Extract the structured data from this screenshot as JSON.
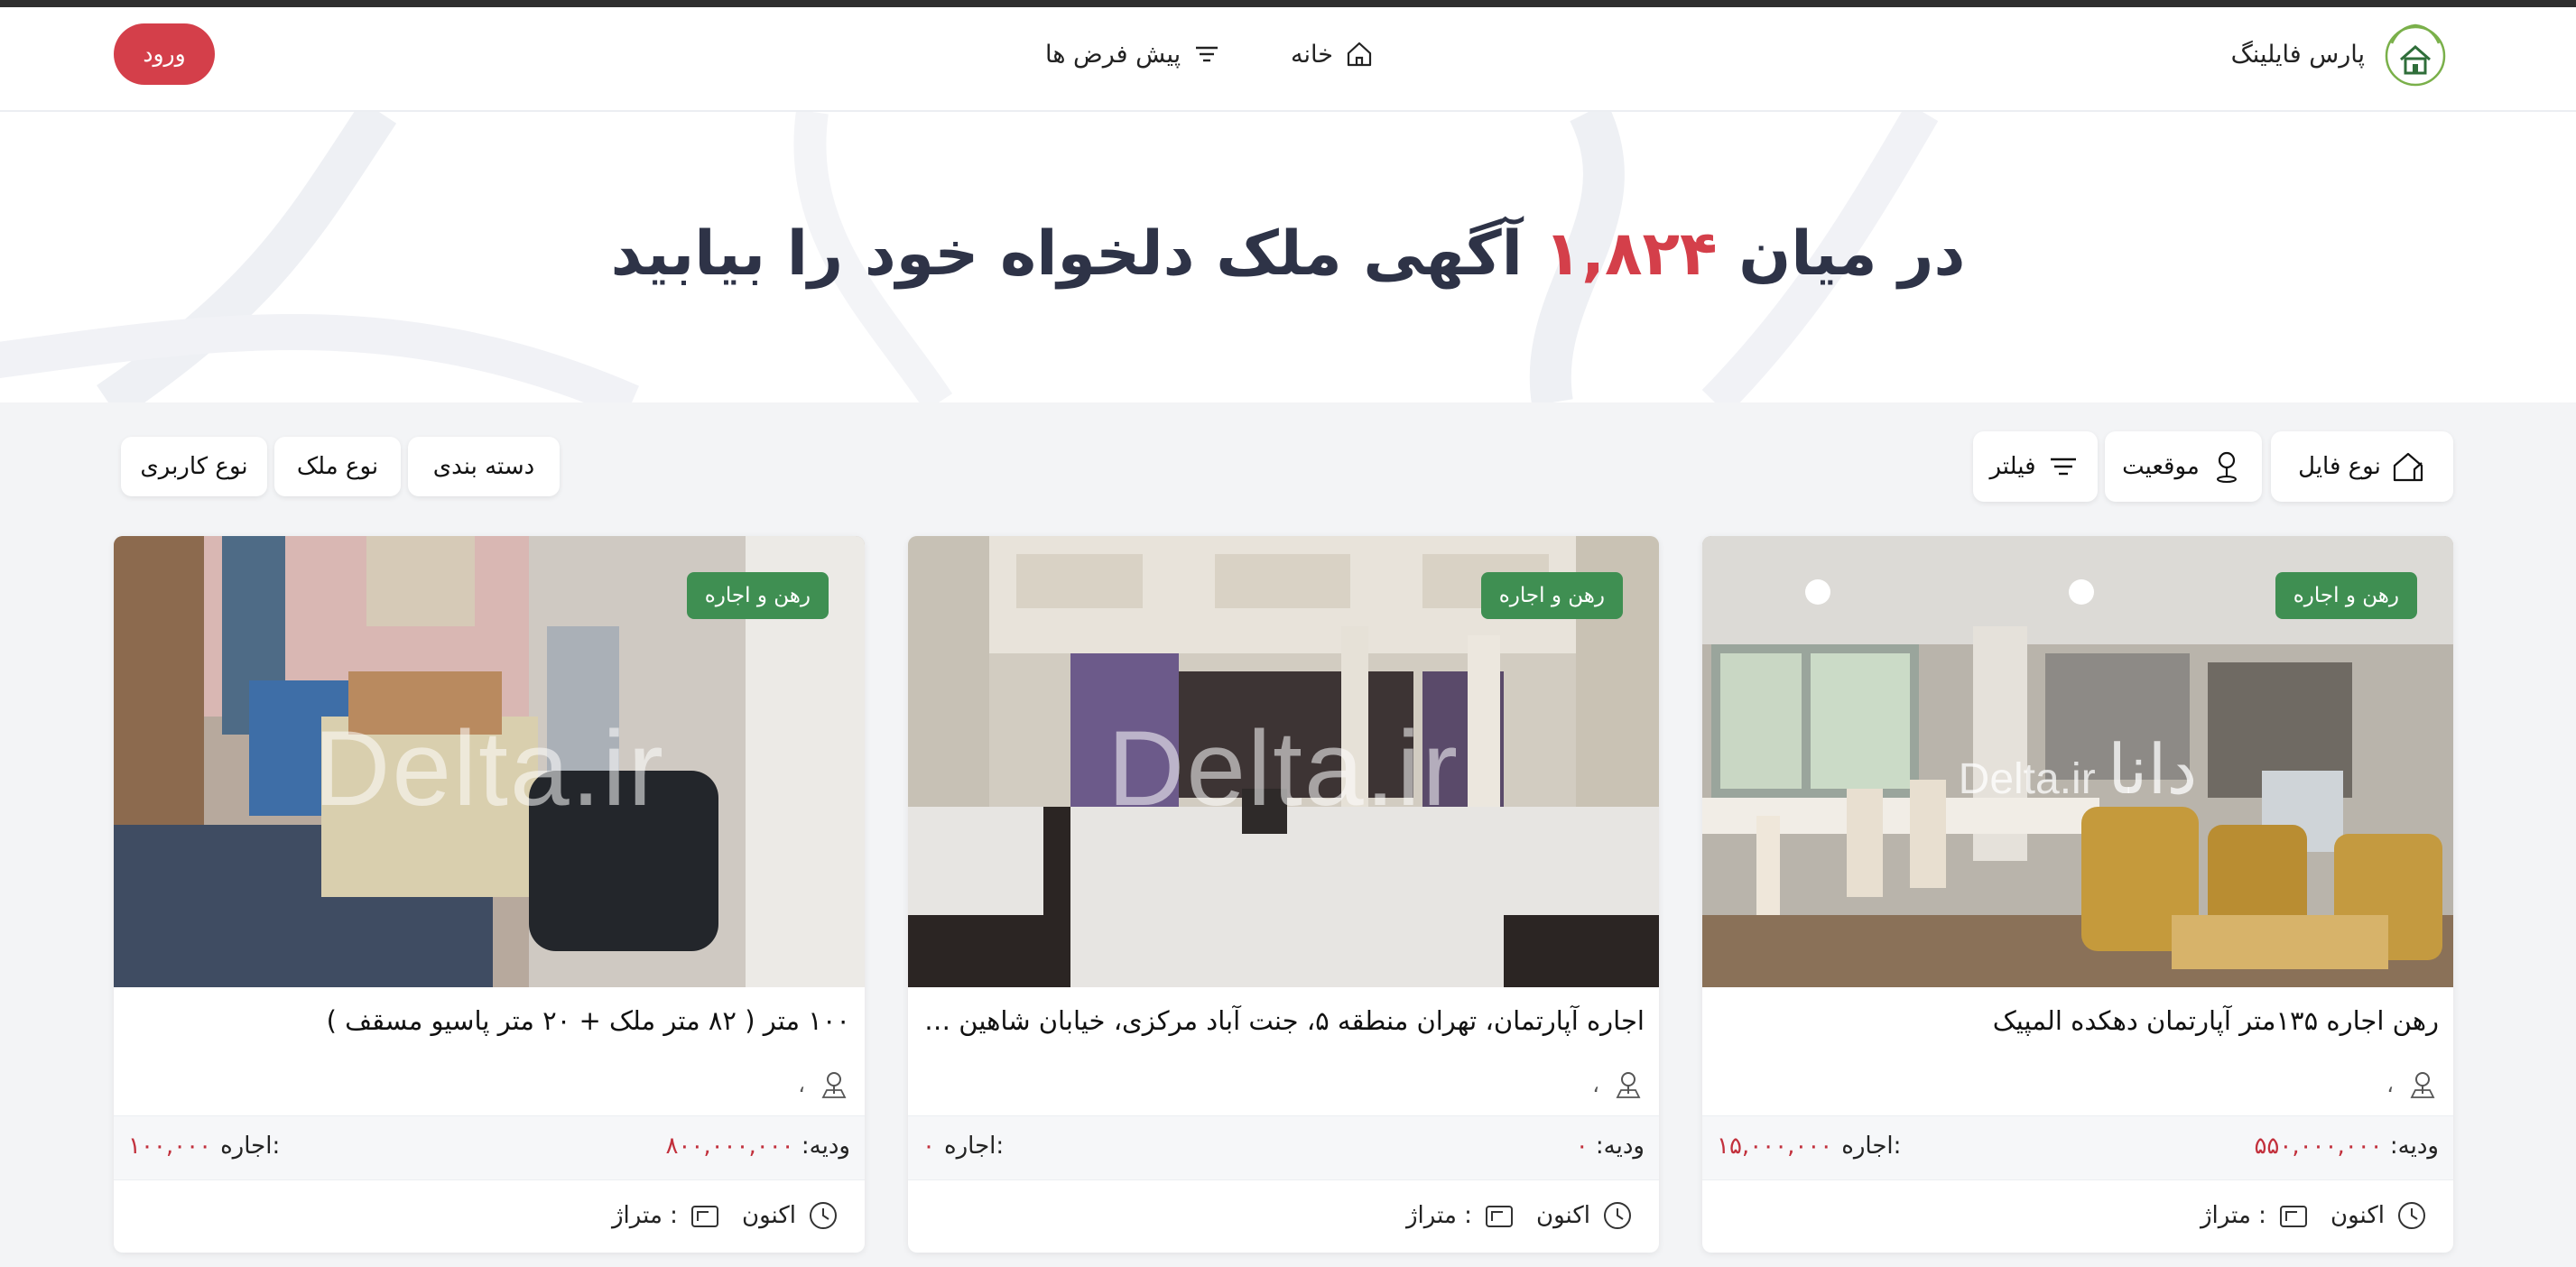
{
  "header": {
    "brand_name": "پارس فایلینگ",
    "nav": {
      "home": "خانه",
      "presets": "پیش فرض ها"
    },
    "login": "ورود"
  },
  "hero": {
    "prefix": "در میان",
    "count": "۱,۸۲۴",
    "suffix": "آگهی ملک دلخواه خود را بیابید"
  },
  "filters": {
    "file_type": "نوع فایل",
    "location": "موقعیت",
    "filter": "فیلتر",
    "category": "دسته بندی",
    "property_type": "نوع ملک",
    "usage_type": "نوع کاربری"
  },
  "labels": {
    "deposit": "ودیه:",
    "rent": "اجاره:",
    "time": "اکنون",
    "area": "متراژ :",
    "location_sep": "،"
  },
  "listings": [
    {
      "badge": "رهن و اجاره",
      "title": "رهن اجاره ۱۳۵متر آپارتمان دهکده المپیک",
      "deposit": "۵۵۰,۰۰۰,۰۰۰",
      "rent": "۱۵,۰۰۰,۰۰۰",
      "watermark": "Delta.ir",
      "watermark_alt": "دانا"
    },
    {
      "badge": "رهن و اجاره",
      "title": "اجاره آپارتمان، تهران منطقه ۵، جنت آباد مرکزی، خیابان شاهین ش...",
      "deposit": "۰",
      "rent": "۰",
      "watermark": "Delta.ir"
    },
    {
      "badge": "رهن و اجاره",
      "title": "۱۰۰ متر ( ۸۲ متر ملک + ۲۰ متر پاسیو مسقف )",
      "deposit": "۸۰۰,۰۰۰,۰۰۰",
      "rent": "۱۰۰,۰۰۰",
      "watermark": "Delta.ir"
    }
  ],
  "colors": {
    "accent": "#d43f4a",
    "badge": "#3f8f52",
    "price": "#c2303c"
  }
}
